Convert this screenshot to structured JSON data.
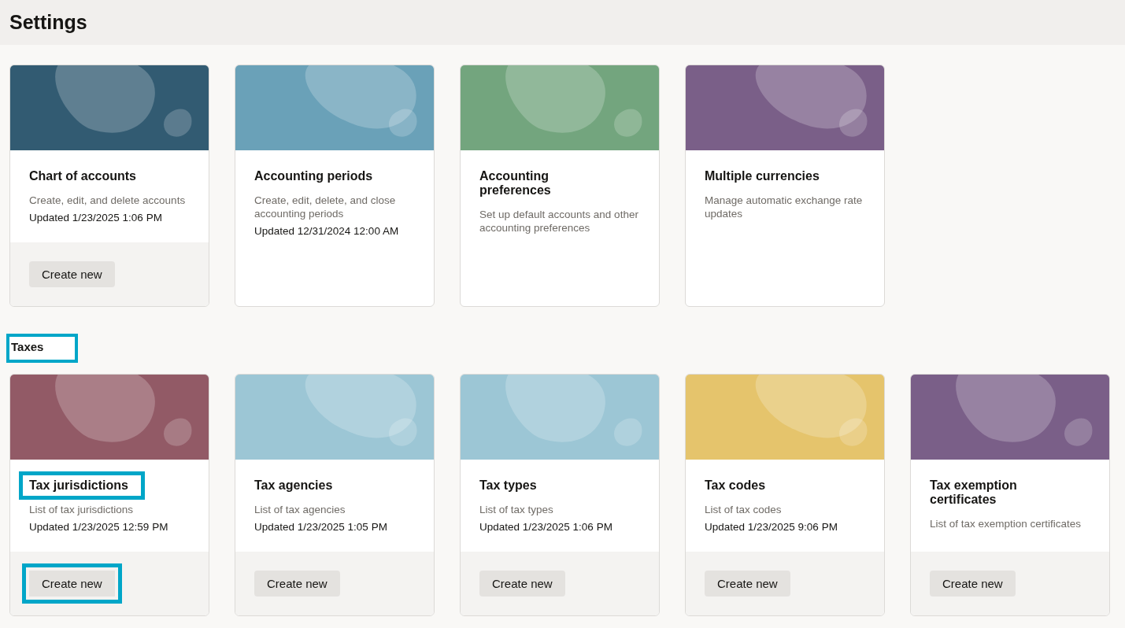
{
  "page_title": "Settings",
  "sections": [
    {
      "cards": [
        {
          "title": "Chart of accounts",
          "title_highlighted": false,
          "description": "Create, edit, and delete accounts",
          "updated": "Updated 1/23/2025 1:06 PM",
          "color": "#325b72",
          "button": "Create new",
          "button_highlighted": false
        },
        {
          "title": "Accounting periods",
          "title_highlighted": false,
          "description": "Create, edit, delete, and close accounting periods",
          "updated": "Updated 12/31/2024 12:00 AM",
          "color": "#6aa1b8"
        },
        {
          "title": "Accounting preferences",
          "title_highlighted": false,
          "description": "Set up default accounts and other accounting preferences",
          "color": "#73a57e"
        },
        {
          "title": "Multiple currencies",
          "title_highlighted": false,
          "description": "Manage automatic exchange rate updates",
          "color": "#7a5f88"
        }
      ]
    },
    {
      "heading": "Taxes",
      "highlighted": true,
      "cards": [
        {
          "title": "Tax jurisdictions",
          "title_highlighted": true,
          "description": "List of tax jurisdictions",
          "updated": "Updated 1/23/2025 12:59 PM",
          "color": "#925a66",
          "button": "Create new",
          "button_highlighted": true
        },
        {
          "title": "Tax agencies",
          "title_highlighted": false,
          "description": "List of tax agencies",
          "updated": "Updated 1/23/2025 1:05 PM",
          "color": "#9cc6d5",
          "button": "Create new",
          "button_highlighted": false
        },
        {
          "title": "Tax types",
          "title_highlighted": false,
          "description": "List of tax types",
          "updated": "Updated 1/23/2025 1:06 PM",
          "color": "#9cc6d5",
          "button": "Create new",
          "button_highlighted": false
        },
        {
          "title": "Tax codes",
          "title_highlighted": false,
          "description": "List of tax codes",
          "updated": "Updated 1/23/2025 9:06 PM",
          "color": "#e5c46c",
          "button": "Create new",
          "button_highlighted": false
        },
        {
          "title": "Tax exemption certificates",
          "title_highlighted": false,
          "description": "List of tax exemption certificates",
          "color": "#7a5f88",
          "button": "Create new",
          "button_highlighted": false
        }
      ]
    }
  ]
}
